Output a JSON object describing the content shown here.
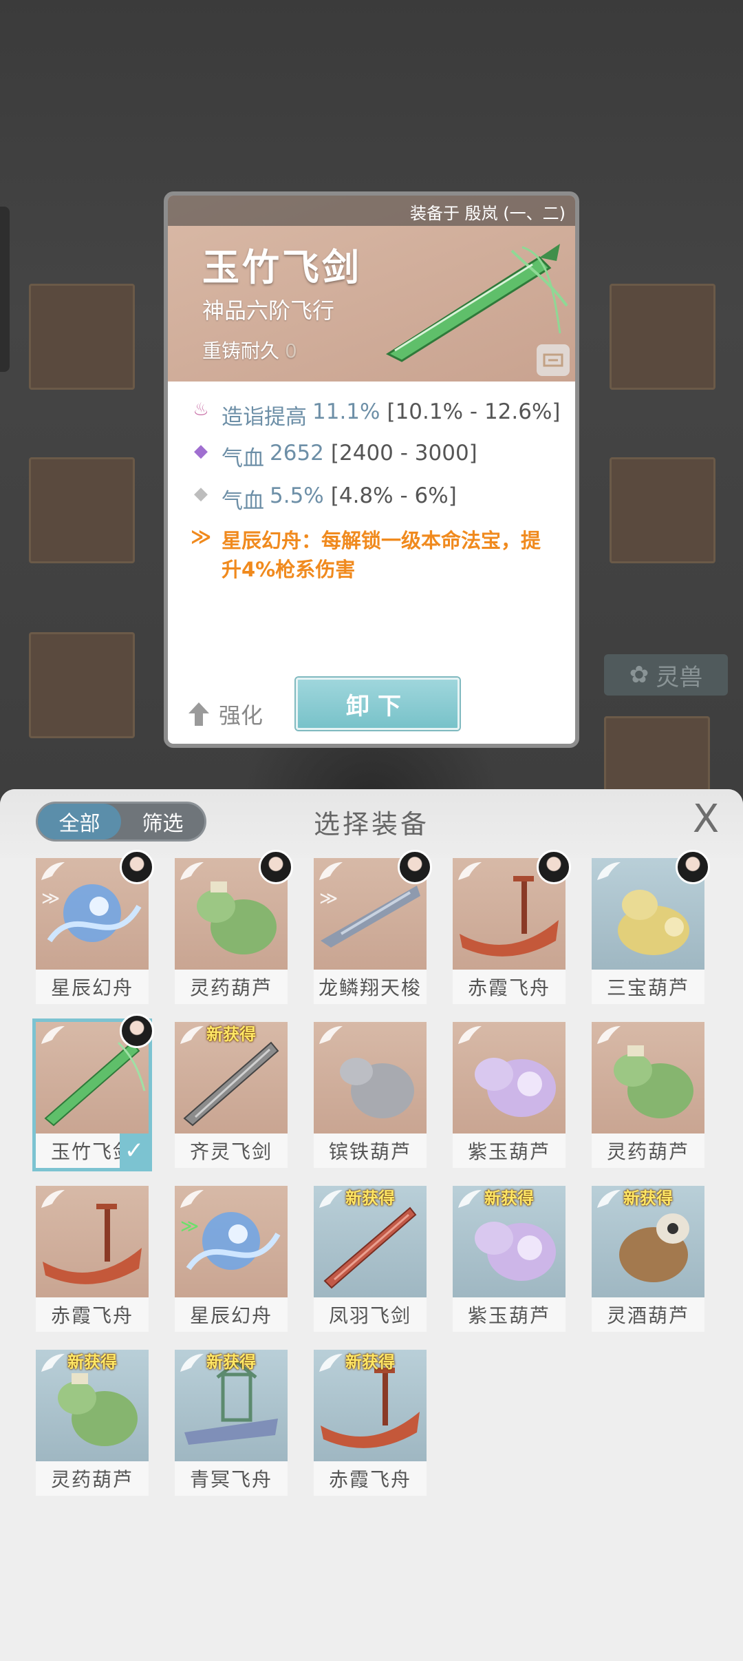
{
  "detail": {
    "equipped_to": "装备于 殷岚 (一、二)",
    "name": "玉竹飞剑",
    "grade": "神品六阶飞行",
    "durability_label": "重铸耐久",
    "durability_value": "0",
    "stats": [
      {
        "icon": "flame-icon",
        "name": "造诣提高",
        "value": "11.1%",
        "range": "[10.1% - 12.6%]",
        "color": "#c86ea6"
      },
      {
        "icon": "purple-diamond-icon",
        "name": "气血",
        "value": "2652",
        "range": "[2400 - 3000]",
        "color": "#a06fd0"
      },
      {
        "icon": "gray-diamond-icon",
        "name": "气血",
        "value": "5.5%",
        "range": "[4.8% - 6%]",
        "color": "#bdbdbd"
      }
    ],
    "special_effect": "星辰幻舟：每解锁一级本命法宝，提升4%枪系伤害",
    "strengthen_label": "强化",
    "unequip_label": "卸下"
  },
  "background": {
    "tab_label": "灵兽"
  },
  "panel": {
    "filter_all": "全部",
    "filter_select": "筛选",
    "title": "选择装备",
    "close": "X",
    "new_badge": "新获得",
    "items": [
      {
        "label": "星辰幻舟",
        "bg": "pink",
        "avatar": true,
        "mark": true,
        "new": false,
        "art": "blue-swirl"
      },
      {
        "label": "灵药葫芦",
        "bg": "pink",
        "avatar": true,
        "mark": false,
        "new": false,
        "art": "green-gourd"
      },
      {
        "label": "龙鳞翔天梭",
        "bg": "pink",
        "avatar": true,
        "mark": true,
        "new": false,
        "art": "gray-shuttle"
      },
      {
        "label": "赤霞飞舟",
        "bg": "pink",
        "avatar": true,
        "mark": false,
        "new": false,
        "art": "red-boat"
      },
      {
        "label": "三宝葫芦",
        "bg": "blue",
        "avatar": true,
        "mark": false,
        "new": false,
        "art": "gold-gourd"
      },
      {
        "label": "玉竹飞剑",
        "bg": "pink",
        "avatar": true,
        "mark": false,
        "new": false,
        "art": "green-sword",
        "selected": true
      },
      {
        "label": "齐灵飞剑",
        "bg": "pink",
        "avatar": false,
        "mark": false,
        "new": true,
        "art": "gray-sword"
      },
      {
        "label": "镔铁葫芦",
        "bg": "pink",
        "avatar": false,
        "mark": false,
        "new": false,
        "art": "gray-gourd"
      },
      {
        "label": "紫玉葫芦",
        "bg": "pink",
        "avatar": false,
        "mark": false,
        "new": false,
        "art": "purple-gourd"
      },
      {
        "label": "灵药葫芦",
        "bg": "pink",
        "avatar": false,
        "mark": false,
        "new": false,
        "art": "green-gourd"
      },
      {
        "label": "赤霞飞舟",
        "bg": "pink",
        "avatar": false,
        "mark": false,
        "new": false,
        "art": "red-boat"
      },
      {
        "label": "星辰幻舟",
        "bg": "pink",
        "avatar": false,
        "mark": true,
        "markGreen": true,
        "new": false,
        "art": "blue-swirl"
      },
      {
        "label": "凤羽飞剑",
        "bg": "blue",
        "avatar": false,
        "mark": false,
        "new": true,
        "art": "red-sword"
      },
      {
        "label": "紫玉葫芦",
        "bg": "blue",
        "avatar": false,
        "mark": false,
        "new": true,
        "art": "purple-gourd"
      },
      {
        "label": "灵酒葫芦",
        "bg": "blue",
        "avatar": false,
        "mark": false,
        "new": true,
        "art": "brown-gourd"
      },
      {
        "label": "灵药葫芦",
        "bg": "blue",
        "avatar": false,
        "mark": false,
        "new": true,
        "art": "green-gourd"
      },
      {
        "label": "青冥飞舟",
        "bg": "blue",
        "avatar": false,
        "mark": false,
        "new": true,
        "art": "teal-boat"
      },
      {
        "label": "赤霞飞舟",
        "bg": "blue",
        "avatar": false,
        "mark": false,
        "new": true,
        "art": "red-boat"
      }
    ]
  }
}
